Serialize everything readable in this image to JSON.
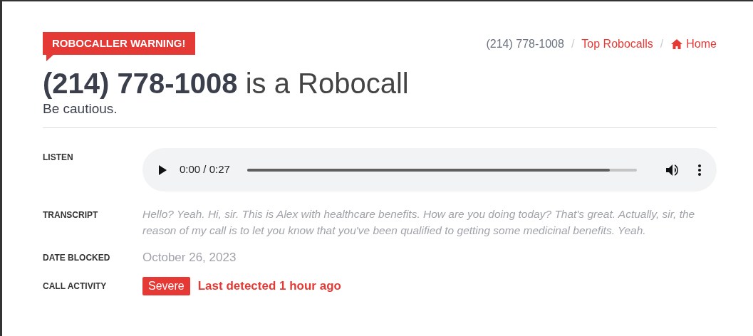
{
  "banner": "ROBOCALLER WARNING!",
  "breadcrumb_separator": "/",
  "breadcrumb": [
    {
      "label": "(214) 778-1008",
      "kind": "current"
    },
    {
      "label": "Top Robocalls",
      "kind": "link"
    },
    {
      "label": "Home",
      "kind": "home"
    }
  ],
  "heading": {
    "number": "(214) 778-1008",
    "rest": "is a Robocall"
  },
  "subtitle": "Be cautious.",
  "details": [
    {
      "label": "LISTEN",
      "kind": "audio",
      "time": "0:00 / 0:27",
      "level": 0.93
    },
    {
      "label": "TRANSCRIPT",
      "kind": "transcript",
      "text": "Hello? Yeah. Hi, sir. This is Alex with healthcare benefits. How are you doing today? That's great. Actually, sir, the reason of my call is to let you know that you've been qualified to getting some medicinal benefits. Yeah."
    },
    {
      "label": "DATE BLOCKED",
      "kind": "date",
      "text": "October 26, 2023"
    },
    {
      "label": "CALL ACTIVITY",
      "kind": "activity",
      "badge": "Severe",
      "text": "Last detected 1 hour ago"
    }
  ]
}
